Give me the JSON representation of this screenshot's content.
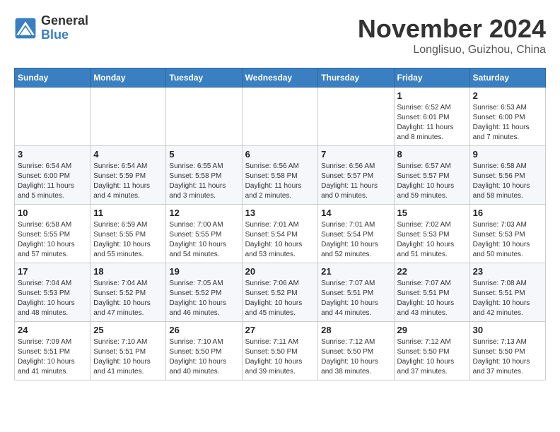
{
  "header": {
    "logo_general": "General",
    "logo_blue": "Blue",
    "month_title": "November 2024",
    "location": "Longlisuo, Guizhou, China"
  },
  "days_of_week": [
    "Sunday",
    "Monday",
    "Tuesday",
    "Wednesday",
    "Thursday",
    "Friday",
    "Saturday"
  ],
  "weeks": [
    [
      {
        "day": "",
        "info": ""
      },
      {
        "day": "",
        "info": ""
      },
      {
        "day": "",
        "info": ""
      },
      {
        "day": "",
        "info": ""
      },
      {
        "day": "",
        "info": ""
      },
      {
        "day": "1",
        "info": "Sunrise: 6:52 AM\nSunset: 6:01 PM\nDaylight: 11 hours\nand 8 minutes."
      },
      {
        "day": "2",
        "info": "Sunrise: 6:53 AM\nSunset: 6:00 PM\nDaylight: 11 hours\nand 7 minutes."
      }
    ],
    [
      {
        "day": "3",
        "info": "Sunrise: 6:54 AM\nSunset: 6:00 PM\nDaylight: 11 hours\nand 5 minutes."
      },
      {
        "day": "4",
        "info": "Sunrise: 6:54 AM\nSunset: 5:59 PM\nDaylight: 11 hours\nand 4 minutes."
      },
      {
        "day": "5",
        "info": "Sunrise: 6:55 AM\nSunset: 5:58 PM\nDaylight: 11 hours\nand 3 minutes."
      },
      {
        "day": "6",
        "info": "Sunrise: 6:56 AM\nSunset: 5:58 PM\nDaylight: 11 hours\nand 2 minutes."
      },
      {
        "day": "7",
        "info": "Sunrise: 6:56 AM\nSunset: 5:57 PM\nDaylight: 11 hours\nand 0 minutes."
      },
      {
        "day": "8",
        "info": "Sunrise: 6:57 AM\nSunset: 5:57 PM\nDaylight: 10 hours\nand 59 minutes."
      },
      {
        "day": "9",
        "info": "Sunrise: 6:58 AM\nSunset: 5:56 PM\nDaylight: 10 hours\nand 58 minutes."
      }
    ],
    [
      {
        "day": "10",
        "info": "Sunrise: 6:58 AM\nSunset: 5:55 PM\nDaylight: 10 hours\nand 57 minutes."
      },
      {
        "day": "11",
        "info": "Sunrise: 6:59 AM\nSunset: 5:55 PM\nDaylight: 10 hours\nand 55 minutes."
      },
      {
        "day": "12",
        "info": "Sunrise: 7:00 AM\nSunset: 5:55 PM\nDaylight: 10 hours\nand 54 minutes."
      },
      {
        "day": "13",
        "info": "Sunrise: 7:01 AM\nSunset: 5:54 PM\nDaylight: 10 hours\nand 53 minutes."
      },
      {
        "day": "14",
        "info": "Sunrise: 7:01 AM\nSunset: 5:54 PM\nDaylight: 10 hours\nand 52 minutes."
      },
      {
        "day": "15",
        "info": "Sunrise: 7:02 AM\nSunset: 5:53 PM\nDaylight: 10 hours\nand 51 minutes."
      },
      {
        "day": "16",
        "info": "Sunrise: 7:03 AM\nSunset: 5:53 PM\nDaylight: 10 hours\nand 50 minutes."
      }
    ],
    [
      {
        "day": "17",
        "info": "Sunrise: 7:04 AM\nSunset: 5:53 PM\nDaylight: 10 hours\nand 48 minutes."
      },
      {
        "day": "18",
        "info": "Sunrise: 7:04 AM\nSunset: 5:52 PM\nDaylight: 10 hours\nand 47 minutes."
      },
      {
        "day": "19",
        "info": "Sunrise: 7:05 AM\nSunset: 5:52 PM\nDaylight: 10 hours\nand 46 minutes."
      },
      {
        "day": "20",
        "info": "Sunrise: 7:06 AM\nSunset: 5:52 PM\nDaylight: 10 hours\nand 45 minutes."
      },
      {
        "day": "21",
        "info": "Sunrise: 7:07 AM\nSunset: 5:51 PM\nDaylight: 10 hours\nand 44 minutes."
      },
      {
        "day": "22",
        "info": "Sunrise: 7:07 AM\nSunset: 5:51 PM\nDaylight: 10 hours\nand 43 minutes."
      },
      {
        "day": "23",
        "info": "Sunrise: 7:08 AM\nSunset: 5:51 PM\nDaylight: 10 hours\nand 42 minutes."
      }
    ],
    [
      {
        "day": "24",
        "info": "Sunrise: 7:09 AM\nSunset: 5:51 PM\nDaylight: 10 hours\nand 41 minutes."
      },
      {
        "day": "25",
        "info": "Sunrise: 7:10 AM\nSunset: 5:51 PM\nDaylight: 10 hours\nand 41 minutes."
      },
      {
        "day": "26",
        "info": "Sunrise: 7:10 AM\nSunset: 5:50 PM\nDaylight: 10 hours\nand 40 minutes."
      },
      {
        "day": "27",
        "info": "Sunrise: 7:11 AM\nSunset: 5:50 PM\nDaylight: 10 hours\nand 39 minutes."
      },
      {
        "day": "28",
        "info": "Sunrise: 7:12 AM\nSunset: 5:50 PM\nDaylight: 10 hours\nand 38 minutes."
      },
      {
        "day": "29",
        "info": "Sunrise: 7:12 AM\nSunset: 5:50 PM\nDaylight: 10 hours\nand 37 minutes."
      },
      {
        "day": "30",
        "info": "Sunrise: 7:13 AM\nSunset: 5:50 PM\nDaylight: 10 hours\nand 37 minutes."
      }
    ]
  ]
}
